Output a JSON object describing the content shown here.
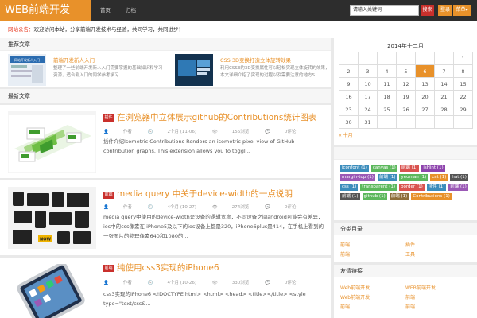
{
  "header": {
    "logo": "WEB前端开发",
    "nav": [
      "首页",
      "归档"
    ],
    "search_placeholder": "请输入关键词",
    "search_button": "搜索",
    "login_button": "登录",
    "menu_button": "菜单"
  },
  "notice": {
    "highlight": "网站公告：",
    "text": "欢迎访问本站，分享前端开发技术与经验，共同学习，共同进步！"
  },
  "featured": {
    "heading": "推荐文章",
    "items": [
      {
        "thumb_label": "网站开发新人入门",
        "title": "前端开发新人入门",
        "desc": "整理了一些前端开发新人入门需要掌握的基础知识和学习资源，适合刚入门的同学参考学习……"
      },
      {
        "thumb_label": "",
        "title": "CSS 3D变换打造立体旋转效果",
        "desc": "利用CSS3的3D变换属性可以轻松实现立体旋转的效果，本文详细介绍了实现的过程以及需要注意的地方S……"
      }
    ]
  },
  "articles": {
    "heading": "最新文章",
    "items": [
      {
        "category": "插件",
        "title": "在浏览器中立体展示github的Contributions统计图表",
        "author": "作者",
        "date": "2个月 (11-06)",
        "views": "156浏览",
        "comments": "0评论",
        "excerpt": "插件介绍Isometric Contributions Renders an isometric pixel view of GitHub contribution graphs. This extension allows you to toggl..."
      },
      {
        "category": "前端",
        "title": "media query 中关于device-width的一点说明",
        "author": "作者",
        "date": "4个月 (10-27)",
        "views": "274浏览",
        "comments": "0评论",
        "excerpt": "media query中使用的device-width是设备的逻辑宽度，不同设备之间android可能会有差异，ios中的css像素在 iPhone5及以下的ios设备上都是320，iPhone6plus是414，在手机上看到的一张图片的物理像素640和1080的..."
      },
      {
        "category": "前端",
        "title": "纯使用css3实现的iPhone6",
        "author": "作者",
        "date": "4个月 (10-26)",
        "views": "330浏览",
        "comments": "0评论",
        "excerpt": "css3实现的iPhone6 <!DOCTYPE html> <html> <head> <title></title> <style type=\"text/css&..."
      }
    ]
  },
  "calendar": {
    "title": "2014年十二月",
    "weeks": [
      [
        "",
        "",
        "",
        "",
        "",
        "",
        "1"
      ],
      [
        "2",
        "3",
        "4",
        "5",
        "6",
        "7",
        "8"
      ],
      [
        "9",
        "10",
        "11",
        "12",
        "13",
        "14",
        "15"
      ],
      [
        "16",
        "17",
        "18",
        "19",
        "20",
        "21",
        "22"
      ],
      [
        "23",
        "24",
        "25",
        "26",
        "27",
        "28",
        "29"
      ],
      [
        "30",
        "31",
        "",
        "",
        "",
        "",
        ""
      ]
    ],
    "highlighted_day": "6",
    "prev": "« 十月"
  },
  "tags": {
    "items": [
      {
        "label": "iconfont (1)",
        "color": "#3c8dbc"
      },
      {
        "label": "canvas (1)",
        "color": "#5cb85c"
      },
      {
        "label": "前端 (1)",
        "color": "#d9534f"
      },
      {
        "label": "jsHint (1)",
        "color": "#8e44ad"
      },
      {
        "label": "margin-top (1)",
        "color": "#9b59b6"
      },
      {
        "label": "前端 (1)",
        "color": "#3c8dbc"
      },
      {
        "label": "yeoman (1)",
        "color": "#5cb85c"
      },
      {
        "label": "cat (1)",
        "color": "#e8912a"
      },
      {
        "label": "hat (1)",
        "color": "#555555"
      },
      {
        "label": "css (1)",
        "color": "#3c8dbc"
      },
      {
        "label": "transparent (1)",
        "color": "#5cb85c"
      },
      {
        "label": "border (1)",
        "color": "#d9534f"
      },
      {
        "label": "插件 (1)",
        "color": "#3c8dbc"
      },
      {
        "label": "前端 (1)",
        "color": "#9b59b6"
      },
      {
        "label": "前端 (1)",
        "color": "#555555"
      },
      {
        "label": "github (1)",
        "color": "#5cb85c"
      },
      {
        "label": "前端 (1)",
        "color": "#8e6e3a"
      },
      {
        "label": "Contributions (1)",
        "color": "#e8912a"
      }
    ]
  },
  "categories": {
    "heading": "分类目录",
    "rows": [
      [
        "前端",
        "插件"
      ],
      [
        "前端",
        "工具"
      ]
    ]
  },
  "links": {
    "heading": "友情链接",
    "rows": [
      [
        "Web前端开发",
        "WEB前端开发"
      ],
      [
        "Web前端开发",
        "前端"
      ],
      [
        "前端",
        "前端"
      ]
    ]
  }
}
